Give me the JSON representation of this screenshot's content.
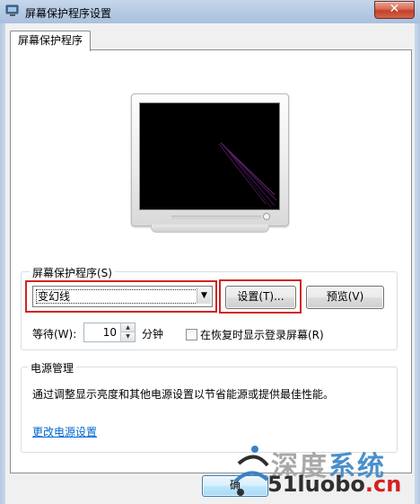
{
  "window": {
    "title": "屏幕保护程序设置",
    "close_glyph": "✕"
  },
  "tabs": [
    {
      "label": "屏幕保护程序",
      "selected": true
    }
  ],
  "screensaver": {
    "group_label": "屏幕保护程序(S)",
    "selected": "变幻线",
    "dropdown_arrow": "▼",
    "settings_button": "设置(T)...",
    "preview_button": "预览(V)",
    "wait_label": "等待(W):",
    "wait_value": "10",
    "wait_unit": "分钟",
    "resume_checkbox_label": "在恢复时显示登录屏幕(R)",
    "resume_checked": false
  },
  "power": {
    "group_label": "电源管理",
    "description": "通过调整显示亮度和其他电源设置以节省能源或提供最佳性能。",
    "link": "更改电源设置"
  },
  "footer": {
    "ok_button": "确"
  },
  "watermark": {
    "line1_prefix": "深度",
    "line1_suffix": "系统",
    "line2_prefix": "51luobo",
    "line2_suffix": ".cn"
  },
  "colors": {
    "highlight_red": "#d12424",
    "link_blue": "#0066cc",
    "screen_black": "#000000",
    "screensaver_line": "#7a2a8c"
  }
}
